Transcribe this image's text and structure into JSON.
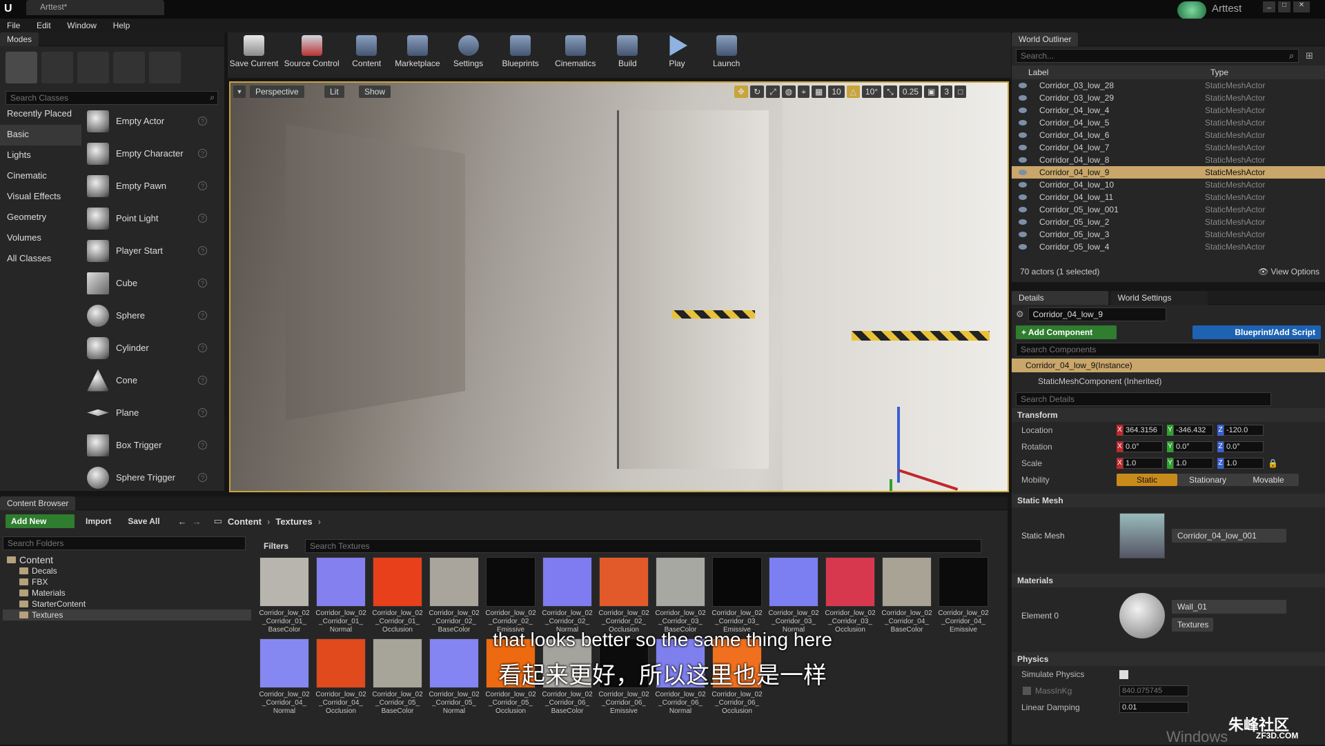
{
  "window": {
    "title": "Arttest*",
    "project": "Arttest"
  },
  "menu": [
    "File",
    "Edit",
    "Window",
    "Help"
  ],
  "modes": {
    "tab": "Modes",
    "search_placeholder": "Search Classes",
    "categories": [
      "Recently Placed",
      "Basic",
      "Lights",
      "Cinematic",
      "Visual Effects",
      "Geometry",
      "Volumes",
      "All Classes"
    ],
    "active_category": "Basic",
    "items": [
      "Empty Actor",
      "Empty Character",
      "Empty Pawn",
      "Point Light",
      "Player Start",
      "Cube",
      "Sphere",
      "Cylinder",
      "Cone",
      "Plane",
      "Box Trigger",
      "Sphere Trigger"
    ]
  },
  "toolbar": [
    "Save Current",
    "Source Control",
    "Content",
    "Marketplace",
    "Settings",
    "Blueprints",
    "Cinematics",
    "Build",
    "Play",
    "Launch"
  ],
  "viewport": {
    "perspective": "Perspective",
    "lit": "Lit",
    "show": "Show",
    "grid": "10",
    "angle": "10°",
    "scale": "0.25",
    "camera_speed": "3"
  },
  "outliner": {
    "tab": "World Outliner",
    "search_placeholder": "Search...",
    "col_label": "Label",
    "col_type": "Type",
    "rows": [
      {
        "label": "Corridor_03_low_28",
        "type": "StaticMeshActor"
      },
      {
        "label": "Corridor_03_low_29",
        "type": "StaticMeshActor"
      },
      {
        "label": "Corridor_04_low_4",
        "type": "StaticMeshActor"
      },
      {
        "label": "Corridor_04_low_5",
        "type": "StaticMeshActor"
      },
      {
        "label": "Corridor_04_low_6",
        "type": "StaticMeshActor"
      },
      {
        "label": "Corridor_04_low_7",
        "type": "StaticMeshActor"
      },
      {
        "label": "Corridor_04_low_8",
        "type": "StaticMeshActor"
      },
      {
        "label": "Corridor_04_low_9",
        "type": "StaticMeshActor",
        "selected": true
      },
      {
        "label": "Corridor_04_low_10",
        "type": "StaticMeshActor"
      },
      {
        "label": "Corridor_04_low_11",
        "type": "StaticMeshActor"
      },
      {
        "label": "Corridor_05_low_001",
        "type": "StaticMeshActor"
      },
      {
        "label": "Corridor_05_low_2",
        "type": "StaticMeshActor"
      },
      {
        "label": "Corridor_05_low_3",
        "type": "StaticMeshActor"
      },
      {
        "label": "Corridor_05_low_4",
        "type": "StaticMeshActor"
      }
    ],
    "status": "70 actors (1 selected)",
    "view_options": "View Options"
  },
  "details": {
    "tab_details": "Details",
    "tab_world": "World Settings",
    "name": "Corridor_04_low_9",
    "add_component": "+ Add Component",
    "blueprint": "Blueprint/Add Script",
    "search_components": "Search Components",
    "instance": "Corridor_04_low_9(Instance)",
    "component": "StaticMeshComponent (Inherited)",
    "search_details": "Search Details",
    "transform": "Transform",
    "location_label": "Location",
    "rotation_label": "Rotation",
    "scale_label": "Scale",
    "mobility_label": "Mobility",
    "location": [
      "364.3156",
      "-346.432",
      "-120.0"
    ],
    "rotation": [
      "0.0°",
      "0.0°",
      "0.0°"
    ],
    "scale": [
      "1.0",
      "1.0",
      "1.0"
    ],
    "mobility": [
      "Static",
      "Stationary",
      "Movable"
    ],
    "static_mesh_section": "Static Mesh",
    "static_mesh_label": "Static Mesh",
    "static_mesh_value": "Corridor_04_low_001",
    "materials_section": "Materials",
    "element0_label": "Element 0",
    "element0_value": "Wall_01",
    "textures_btn": "Textures",
    "physics_section": "Physics",
    "simulate_physics": "Simulate Physics",
    "mass": "MassInKg",
    "mass_value": "840.075745",
    "linear_damping": "Linear Damping",
    "linear_damping_value": "0.01"
  },
  "content_browser": {
    "tab": "Content Browser",
    "add_new": "Add New",
    "import": "Import",
    "save_all": "Save All",
    "path": [
      "Content",
      "Textures"
    ],
    "search_folders": "Search Folders",
    "filters": "Filters",
    "search_textures": "Search Textures",
    "folders": [
      "Content",
      "Decals",
      "FBX",
      "Materials",
      "StarterContent",
      "Textures"
    ],
    "assets": [
      {
        "l1": "Corridor_low_02",
        "l2": "_Corridor_01_",
        "l3": "BaseColor",
        "color": "#b8b5ae"
      },
      {
        "l1": "Corridor_low_02",
        "l2": "_Corridor_01_",
        "l3": "Normal",
        "color": "#8480f0"
      },
      {
        "l1": "Corridor_low_02",
        "l2": "_Corridor_01_",
        "l3": "Occlusion",
        "color": "#e8401a"
      },
      {
        "l1": "Corridor_low_02",
        "l2": "_Corridor_02_",
        "l3": "BaseColor",
        "color": "#a9a59c"
      },
      {
        "l1": "Corridor_low_02",
        "l2": "_Corridor_02_",
        "l3": "Emissive",
        "color": "#0a0a0a"
      },
      {
        "l1": "Corridor_low_02",
        "l2": "_Corridor_02_",
        "l3": "Normal",
        "color": "#7e7cf0"
      },
      {
        "l1": "Corridor_low_02",
        "l2": "_Corridor_02_",
        "l3": "Occlusion",
        "color": "#e35a2a"
      },
      {
        "l1": "Corridor_low_02",
        "l2": "_Corridor_03_",
        "l3": "BaseColor",
        "color": "#a8a8a2"
      },
      {
        "l1": "Corridor_low_02",
        "l2": "_Corridor_03_",
        "l3": "Emissive",
        "color": "#080808"
      },
      {
        "l1": "Corridor_low_02",
        "l2": "_Corridor_03_",
        "l3": "Normal",
        "color": "#7b7ff2"
      },
      {
        "l1": "Corridor_low_02",
        "l2": "_Corridor_03_",
        "l3": "Occlusion",
        "color": "#d8384e"
      },
      {
        "l1": "Corridor_low_02",
        "l2": "_Corridor_04_",
        "l3": "BaseColor",
        "color": "#a9a395"
      },
      {
        "l1": "Corridor_low_02",
        "l2": "_Corridor_04_",
        "l3": "Emissive",
        "color": "#0b0b0b"
      },
      {
        "l1": "Corridor_low_02",
        "l2": "_Corridor_04_",
        "l3": "Normal",
        "color": "#8688f2"
      },
      {
        "l1": "Corridor_low_02",
        "l2": "_Corridor_04_",
        "l3": "Occlusion",
        "color": "#e04a1c"
      },
      {
        "l1": "Corridor_low_02",
        "l2": "_Corridor_05_",
        "l3": "BaseColor",
        "color": "#a7a49a"
      },
      {
        "l1": "Corridor_low_02",
        "l2": "_Corridor_05_",
        "l3": "Normal",
        "color": "#8584f3"
      },
      {
        "l1": "Corridor_low_02",
        "l2": "_Corridor_05_",
        "l3": "Occlusion",
        "color": "#ee6a10"
      },
      {
        "l1": "Corridor_low_02",
        "l2": "_Corridor_06_",
        "l3": "BaseColor",
        "color": "#a5a39d"
      },
      {
        "l1": "Corridor_low_02",
        "l2": "_Corridor_06_",
        "l3": "Emissive",
        "color": "#0c0c0c"
      },
      {
        "l1": "Corridor_low_02",
        "l2": "_Corridor_06_",
        "l3": "Normal",
        "color": "#7f80ee"
      },
      {
        "l1": "Corridor_low_02",
        "l2": "_Corridor_06_",
        "l3": "Occlusion",
        "color": "#f07020"
      }
    ]
  },
  "subtitle": {
    "en": "that looks better so the same thing here",
    "zh": "看起来更好，所以这里也是一样"
  },
  "watermark": {
    "brand": "朱峰社区",
    "url": "ZF3D.COM",
    "os": "Windows"
  }
}
